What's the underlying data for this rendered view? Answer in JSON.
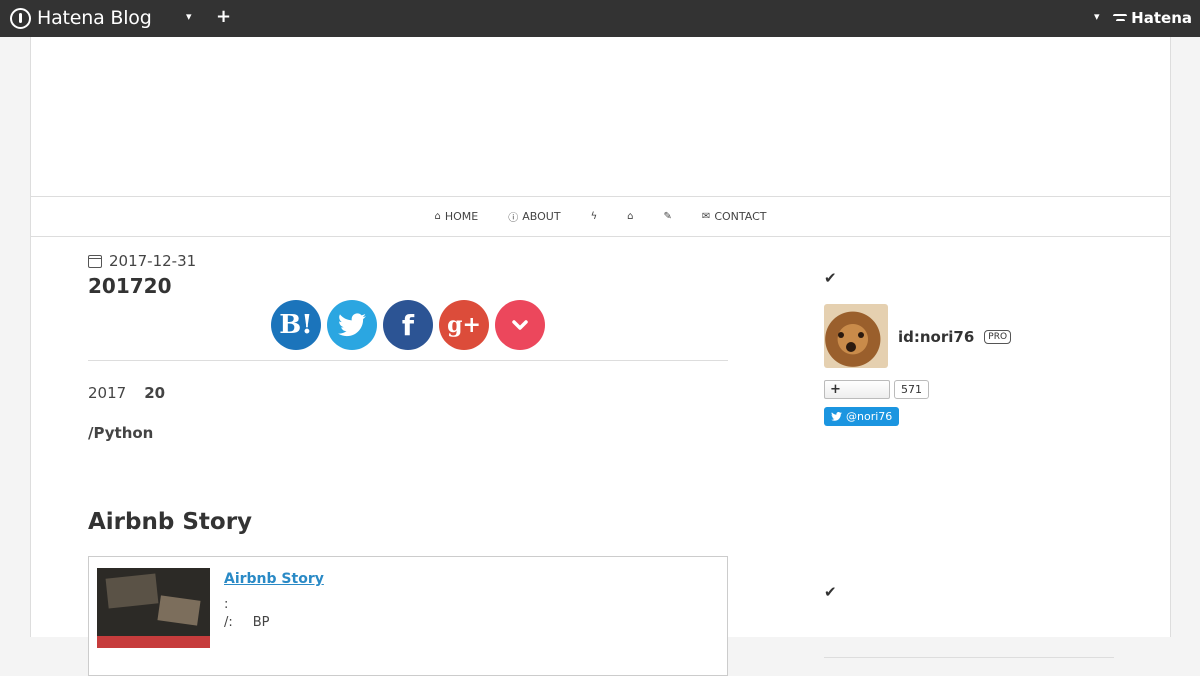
{
  "topbar": {
    "brand": "Hatena Blog",
    "right_brand": "Hatena"
  },
  "nav": {
    "items": [
      {
        "label": "HOME",
        "icon": "home-icon"
      },
      {
        "label": "ABOUT",
        "icon": "info-icon"
      },
      {
        "label": "",
        "icon": "bolt-icon"
      },
      {
        "label": "",
        "icon": "graduation-cap-icon"
      },
      {
        "label": "",
        "icon": "wrench-icon"
      },
      {
        "label": "CONTACT",
        "icon": "envelope-icon"
      }
    ]
  },
  "article": {
    "date": "2017-12-31",
    "title": "201720",
    "share": {
      "hatena": "B!",
      "facebook": "f",
      "google": "g+"
    },
    "para1_a": "2017",
    "para1_b": "20",
    "para2": "/Python",
    "section_title": "Airbnb Story",
    "embed": {
      "title": "Airbnb Story",
      "line1": ":",
      "line2_a": "/:",
      "line2_b": "BP"
    }
  },
  "sidebar": {
    "profile_name": "id:nori76",
    "pro_badge": "PRO",
    "subscribe_label": "+",
    "subscribe_count": "571",
    "twitter_handle": "@nori76"
  },
  "colors": {
    "topbar": "#333333",
    "link": "#2a8ac6",
    "hatena_bookmark": "#1b74bb",
    "twitter": "#2ba6e1",
    "facebook": "#2c5494",
    "google_plus": "#dc4c3a",
    "pocket": "#ec475c"
  }
}
